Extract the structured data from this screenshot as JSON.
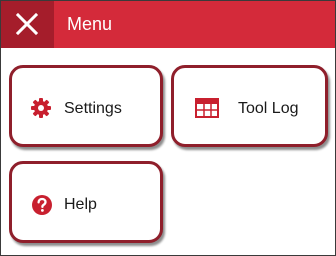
{
  "header": {
    "title": "Menu",
    "close_icon": "close-icon",
    "background_color": "#d42a3a",
    "close_background_color": "#a51d2b"
  },
  "tiles": [
    {
      "label": "Settings",
      "icon": "gear-icon"
    },
    {
      "label": "Tool Log",
      "icon": "table-icon"
    },
    {
      "label": "Help",
      "icon": "question-circle-icon"
    }
  ],
  "colors": {
    "accent": "#d42a3a",
    "tile_border": "#8f1f2b",
    "text": "#1a1a1a"
  }
}
